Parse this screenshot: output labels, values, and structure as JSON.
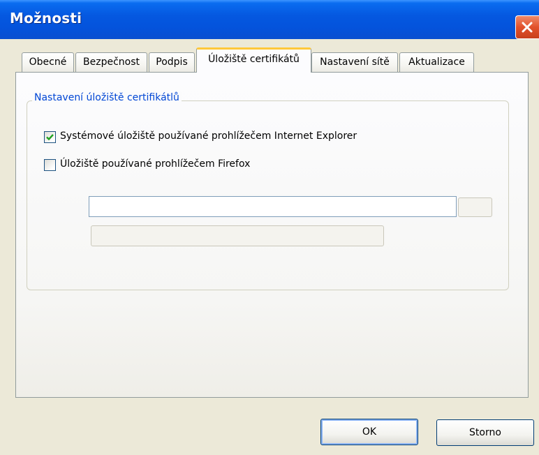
{
  "window": {
    "title": "Možnosti"
  },
  "tabs": [
    {
      "label": "Obecné",
      "active": false
    },
    {
      "label": "Bezpečnost",
      "active": false
    },
    {
      "label": "Podpis",
      "active": false
    },
    {
      "label": "Úložiště certifikátů",
      "active": true
    },
    {
      "label": "Nastavení sítě",
      "active": false
    },
    {
      "label": "Aktualizace",
      "active": false
    }
  ],
  "group": {
    "title": "Nastavení úložiště certifikátlů",
    "options": [
      {
        "label": "Systémové úložiště používané prohlížečem Internet Explorer",
        "checked": true
      },
      {
        "label": "Úložiště používané prohlížečem Firefox",
        "checked": false
      }
    ],
    "path_input": {
      "value": ""
    }
  },
  "buttons": {
    "ok": "OK",
    "cancel": "Storno"
  },
  "colors": {
    "titlebar": "#0558e0",
    "group_title": "#0046d5",
    "active_tab_accent": "#ffc83c",
    "close_button": "#e2512c"
  }
}
